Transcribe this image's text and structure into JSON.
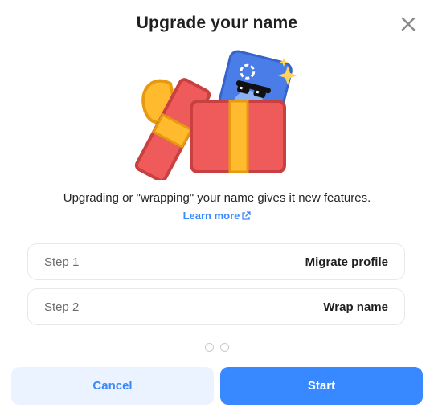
{
  "dialog": {
    "title": "Upgrade your name",
    "close_icon": "close-icon",
    "illustration": "gift-box-illustration",
    "description": "Upgrading or \"wrapping\" your name gives it new features.",
    "learn_more": {
      "label": "Learn more",
      "icon": "external-link-icon"
    },
    "steps": [
      {
        "label": "Step 1",
        "value": "Migrate profile"
      },
      {
        "label": "Step 2",
        "value": "Wrap name"
      }
    ],
    "pagination": {
      "total": 2
    },
    "buttons": {
      "cancel": "Cancel",
      "start": "Start"
    }
  },
  "colors": {
    "accent": "#3889ff",
    "accent_light": "#eaf3ff",
    "gift_red": "#ef5b5b",
    "gift_ribbon": "#ffba2e",
    "card_blue": "#4a7de8"
  }
}
